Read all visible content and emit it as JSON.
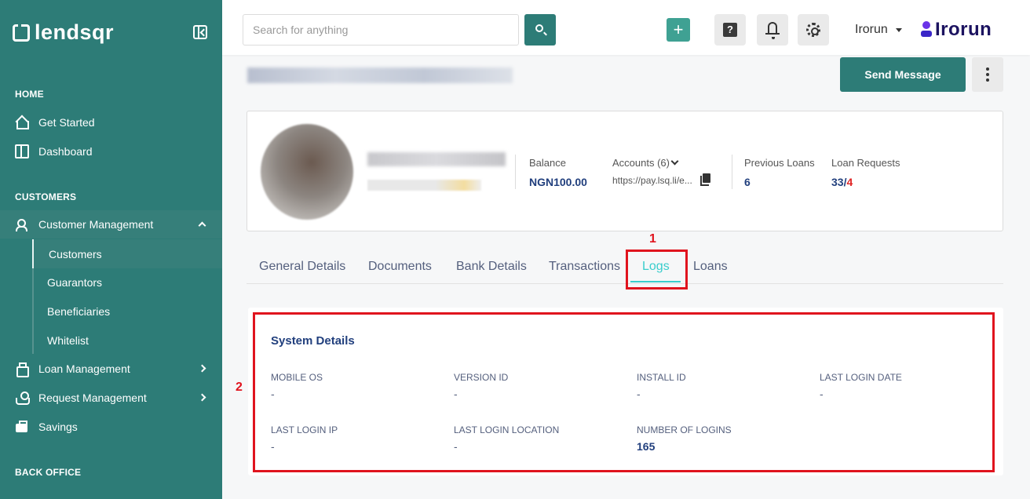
{
  "sidebar": {
    "logo": "lendsqr",
    "sections": {
      "home": "HOME",
      "customers": "CUSTOMERS",
      "back_office": "BACK OFFICE"
    },
    "items": {
      "get_started": "Get Started",
      "dashboard": "Dashboard",
      "customer_management": "Customer Management",
      "loan_management": "Loan Management",
      "request_management": "Request Management",
      "savings": "Savings"
    },
    "sub_items": [
      "Customers",
      "Guarantors",
      "Beneficiaries",
      "Whitelist"
    ]
  },
  "topbar": {
    "search_placeholder": "Search for anything",
    "add_label": "+",
    "help_label": "?",
    "user_name": "Irorun",
    "brand": "Irorun"
  },
  "header": {
    "send_message": "Send Message"
  },
  "profile": {
    "balance_label": "Balance",
    "balance_value": "NGN100.00",
    "accounts_label": "Accounts (6)",
    "accounts_link": "https://pay.lsq.li/e...",
    "previous_loans_label": "Previous Loans",
    "previous_loans_value": "6",
    "loan_requests_label": "Loan Requests",
    "loan_requests_value": "33/",
    "loan_requests_red": "4"
  },
  "tabs": [
    "General Details",
    "Documents",
    "Bank Details",
    "Transactions",
    "Logs",
    "Loans"
  ],
  "active_tab": "Logs",
  "annotations": [
    "1",
    "2"
  ],
  "system_details": {
    "title": "System Details",
    "fields": {
      "mobile_os": {
        "label": "MOBILE OS",
        "value": "-"
      },
      "version_id": {
        "label": "VERSION ID",
        "value": "-"
      },
      "install_id": {
        "label": "INSTALL ID",
        "value": "-"
      },
      "last_login_date": {
        "label": "LAST LOGIN DATE",
        "value": "-"
      },
      "last_login_ip": {
        "label": "LAST LOGIN IP",
        "value": "-"
      },
      "last_login_location": {
        "label": "LAST LOGIN LOCATION",
        "value": "-"
      },
      "number_of_logins": {
        "label": "NUMBER OF LOGINS",
        "value": "165"
      }
    }
  },
  "colors": {
    "primary": "#2d7c77",
    "accent_tab": "#39cdcc",
    "navy": "#213f7d",
    "annotation_red": "#e0141e"
  }
}
